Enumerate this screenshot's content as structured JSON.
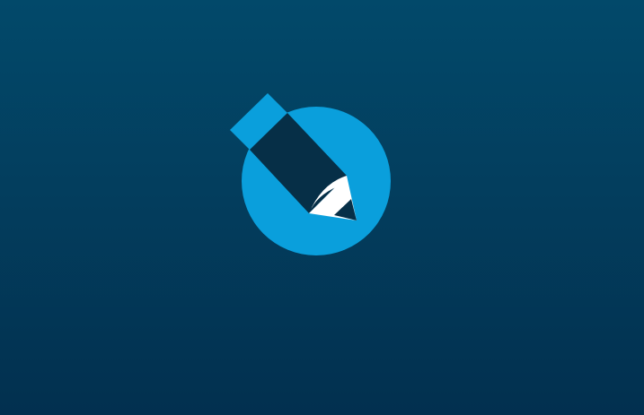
{
  "splash": {
    "logo_icon": "pencil-in-circle-icon"
  },
  "colors": {
    "background_top": "#02496a",
    "background_bottom": "#02304f",
    "circle": "#0a9fdc",
    "pencil_body": "#062f47",
    "pencil_tip_highlight": "#ffffff"
  }
}
